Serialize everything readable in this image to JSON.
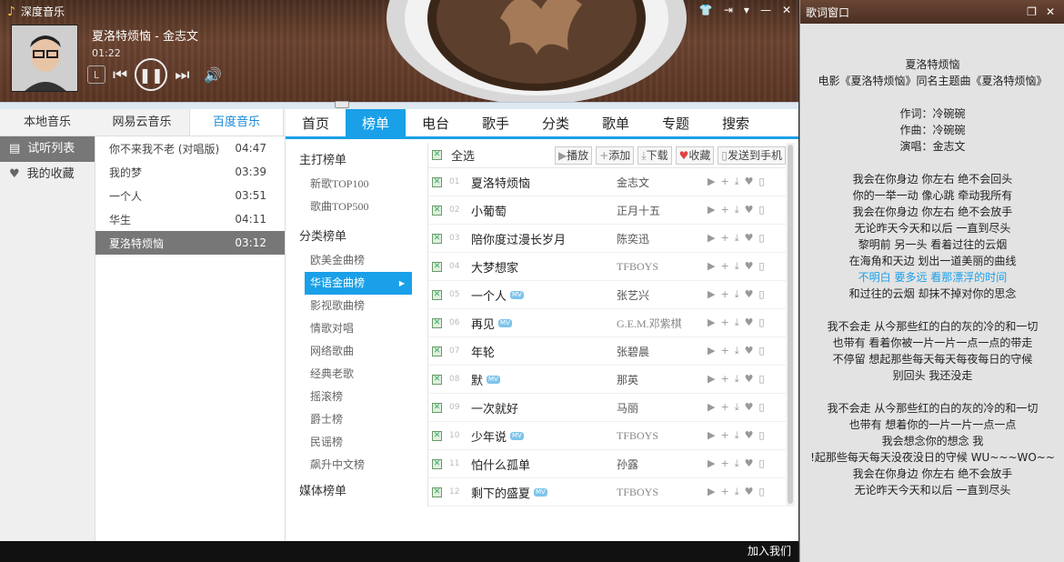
{
  "app": {
    "title": "深度音乐"
  },
  "now_playing": {
    "title": "夏洛特烦恼 - 金志文",
    "time": "01:22",
    "lrc_label": "L"
  },
  "window_buttons": [
    "shirt-icon",
    "exit-icon",
    "menu-icon",
    "minimize-icon",
    "close-icon"
  ],
  "source_tabs": [
    {
      "label": "本地音乐",
      "active": false
    },
    {
      "label": "网易云音乐",
      "active": false
    },
    {
      "label": "百度音乐",
      "active": true
    }
  ],
  "side_nav": [
    {
      "label": "试听列表",
      "icon": "list-icon",
      "active": true
    },
    {
      "label": "我的收藏",
      "icon": "heart-icon",
      "active": false
    }
  ],
  "playlist": [
    {
      "title": "你不来我不老 (对唱版)",
      "duration": "04:47"
    },
    {
      "title": "我的梦",
      "duration": "03:39"
    },
    {
      "title": "一个人",
      "duration": "03:51"
    },
    {
      "title": "华生",
      "duration": "04:11"
    },
    {
      "title": "夏洛特烦恼",
      "duration": "03:12",
      "active": true
    }
  ],
  "main_nav": [
    "首页",
    "榜单",
    "电台",
    "歌手",
    "分类",
    "歌单",
    "专题",
    "搜索"
  ],
  "main_nav_active": "榜单",
  "categories": {
    "group1": {
      "heading": "主打榜单",
      "items": [
        "新歌TOP100",
        "歌曲TOP500"
      ]
    },
    "group2": {
      "heading": "分类榜单",
      "items": [
        "欧美金曲榜",
        "华语金曲榜",
        "影视歌曲榜",
        "情歌对唱",
        "网络歌曲",
        "经典老歌",
        "摇滚榜",
        "爵士榜",
        "民谣榜",
        "飙升中文榜"
      ],
      "active": "华语金曲榜"
    },
    "group3": {
      "heading": "媒体榜单"
    }
  },
  "toolbar": {
    "select_all": "全选",
    "play": "播放",
    "add": "添加",
    "download": "下载",
    "favorite": "收藏",
    "send_to_phone": "发送到手机"
  },
  "songs": [
    {
      "num": "01",
      "title": "夏洛特烦恼",
      "artist": "金志文",
      "mv": false
    },
    {
      "num": "02",
      "title": "小葡萄",
      "artist": "正月十五",
      "mv": false
    },
    {
      "num": "03",
      "title": "陪你度过漫长岁月",
      "artist": "陈奕迅",
      "mv": false
    },
    {
      "num": "04",
      "title": "大梦想家",
      "artist": "TFBOYS",
      "mv": false
    },
    {
      "num": "05",
      "title": "一个人",
      "artist": "张艺兴",
      "mv": true
    },
    {
      "num": "06",
      "title": "再见",
      "artist": "G.E.M.邓紫棋",
      "mv": true
    },
    {
      "num": "07",
      "title": "年轮",
      "artist": "张碧晨",
      "mv": false
    },
    {
      "num": "08",
      "title": "默",
      "artist": "那英",
      "mv": true
    },
    {
      "num": "09",
      "title": "一次就好",
      "artist": "马丽",
      "mv": false
    },
    {
      "num": "10",
      "title": "少年说",
      "artist": "TFBOYS",
      "mv": true
    },
    {
      "num": "11",
      "title": "怕什么孤单",
      "artist": "孙露",
      "mv": false
    },
    {
      "num": "12",
      "title": "剩下的盛夏",
      "artist": "TFBOYS",
      "mv": true
    }
  ],
  "mv_label": "MV",
  "footer": {
    "join": "加入我们"
  },
  "lyric_window": {
    "title": "歌词窗口",
    "lines": [
      "夏洛特烦恼",
      "电影《夏洛特烦恼》同名主题曲《夏洛特烦恼》",
      "",
      "作词：冷碗碗",
      "作曲：冷碗碗",
      "演唱：金志文",
      "",
      "我会在你身边 你左右 绝不会回头",
      "你的一举一动 像心跳 牵动我所有",
      "我会在你身边 你左右 绝不会放手",
      "无论昨天今天和以后 一直到尽头",
      "黎明前 另一头 看着过往的云烟",
      "在海角和天边 划出一道美丽的曲线",
      "不明白 要多远 看那漂浮的时间",
      "和过往的云烟 却抹不掉对你的思念",
      "",
      "我不会走 从今那些红的白的灰的冷的和一切",
      "也带有 看着你被一片一片一点一点的带走",
      "不停留 想起那些每天每天每夜每日的守候",
      "别回头 我还没走",
      "",
      "我不会走 从今那些红的白的灰的冷的和一切",
      "也带有 想着你的一片一片一点一点",
      "我会想念你的想念 我",
      "!起那些每天每天没夜没日的守候 WU~~~WO~~",
      "我会在你身边 你左右 绝不会放手",
      "无论昨天今天和以后 一直到尽头"
    ],
    "highlight_index": 13
  },
  "colors": {
    "accent": "#1aa0e8",
    "header": "#5a3524"
  }
}
